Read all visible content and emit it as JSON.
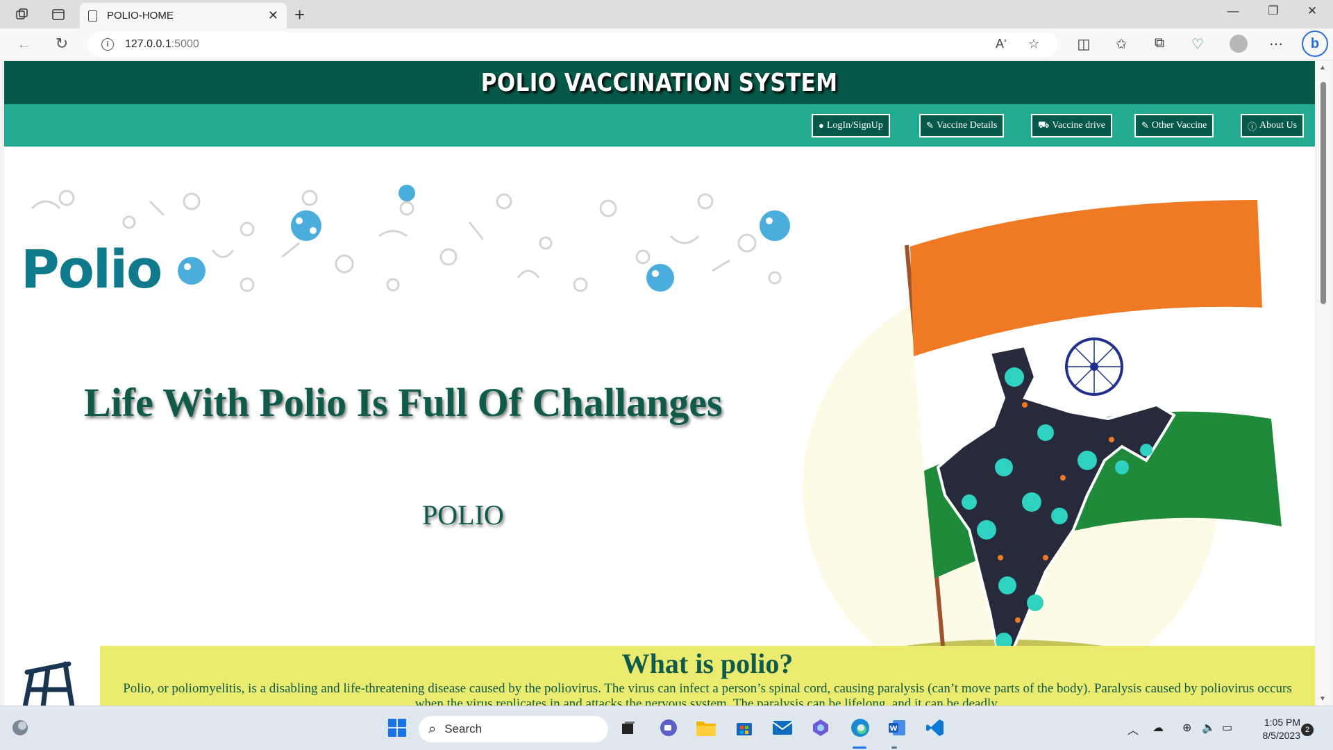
{
  "browser": {
    "tab_title": "POLIO-HOME",
    "url_host": "127.0.0.1",
    "url_port": ":5000"
  },
  "site": {
    "title": "POLIO VACCINATION SYSTEM",
    "nav": [
      {
        "label": "LogIn/SignUp",
        "icon": "user-circle-icon"
      },
      {
        "label": "Vaccine Details",
        "icon": "pencil-icon"
      },
      {
        "label": "Vaccine drive",
        "icon": "car-icon"
      },
      {
        "label": "Other Vaccine",
        "icon": "pencil-icon"
      },
      {
        "label": "About Us",
        "icon": "info-icon"
      }
    ],
    "logo_text": "Polio",
    "hero_heading": "Life With Polio Is Full Of Challanges",
    "hero_sub": "POLIO",
    "info_title": "What is polio?",
    "info_text": "Polio, or poliomyelitis, is a disabling and life-threatening disease caused by the poliovirus. The virus can infect a person’s spinal cord, causing paralysis (can’t move parts of the body). Paralysis caused by poliovirus occurs when the virus replicates in and attacks the nervous system. The paralysis can be lifelong, and it can be deadly."
  },
  "taskbar": {
    "search_label": "Search",
    "time": "1:05 PM",
    "date": "8/5/2023",
    "notification_count": "2"
  },
  "colors": {
    "header": "#075a4a",
    "nav": "#23ab91",
    "info_box": "#ebec6f",
    "saffron": "#f07a23",
    "green": "#1e8a3a"
  }
}
